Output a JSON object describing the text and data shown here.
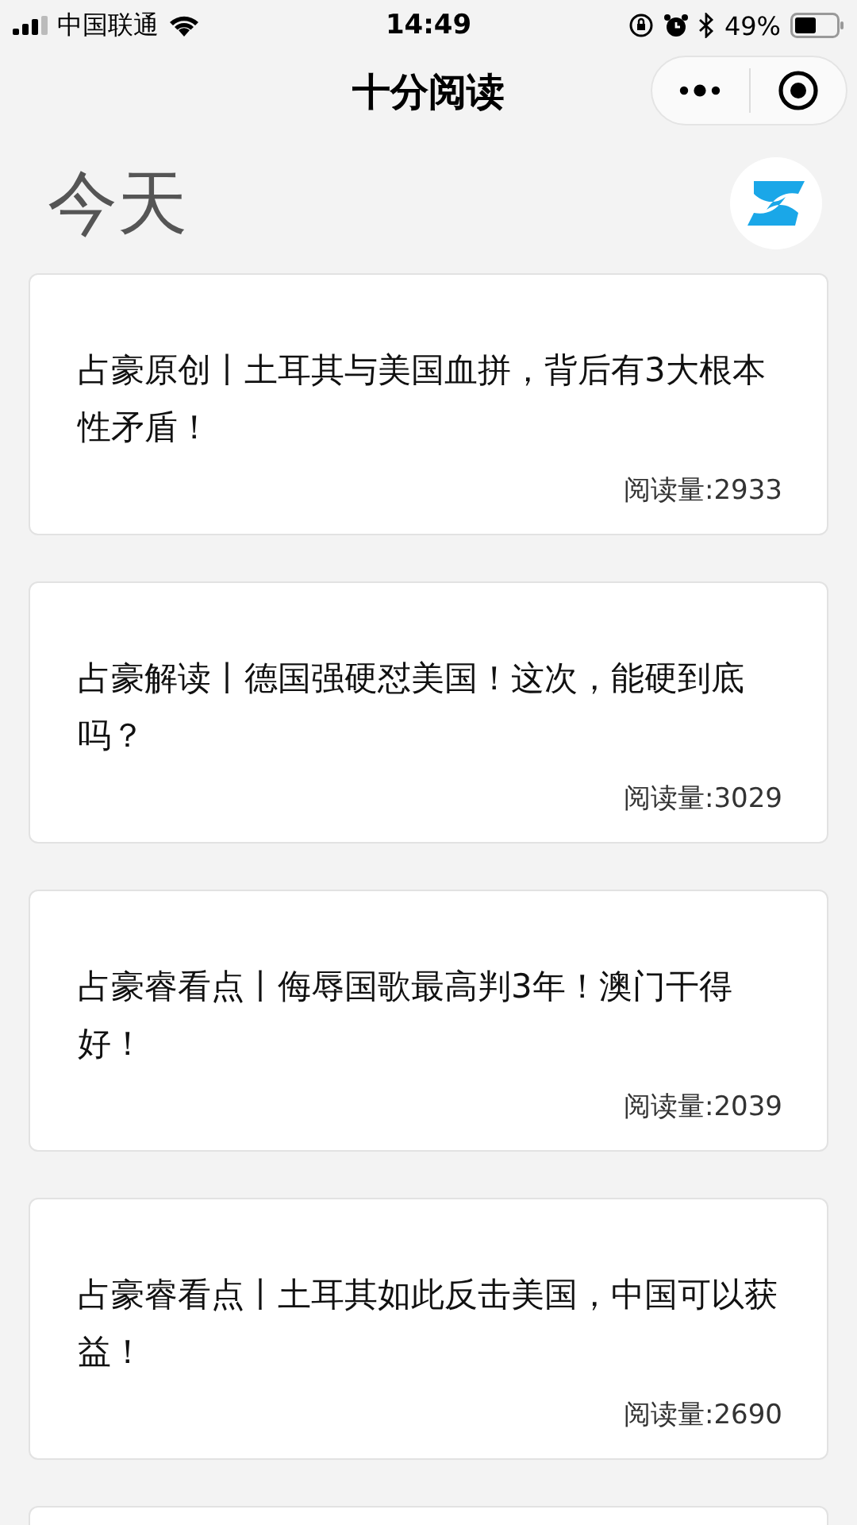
{
  "status_bar": {
    "carrier": "中国联通",
    "time": "14:49",
    "battery": "49%"
  },
  "nav": {
    "title": "十分阅读"
  },
  "header": {
    "title": "今天"
  },
  "articles": [
    {
      "title": "占豪原创丨土耳其与美国血拼，背后有3大根本性矛盾！",
      "reads": "阅读量:2933"
    },
    {
      "title": "占豪解读丨德国强硬怼美国！这次，能硬到底吗？",
      "reads": "阅读量:3029"
    },
    {
      "title": "占豪睿看点丨侮辱国歌最高判3年！澳门干得好！",
      "reads": "阅读量:2039"
    },
    {
      "title": "占豪睿看点丨土耳其如此反击美国，中国可以获益！",
      "reads": "阅读量:2690"
    }
  ]
}
